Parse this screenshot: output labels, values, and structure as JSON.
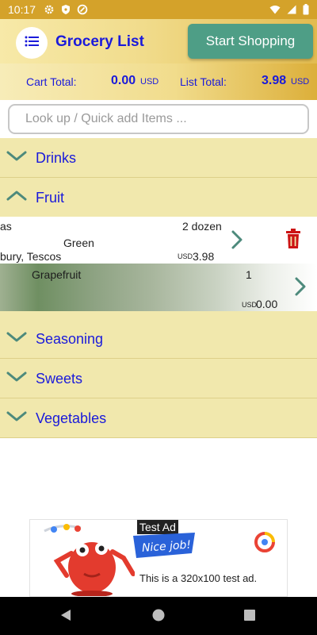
{
  "status_bar": {
    "time": "10:17"
  },
  "app_bar": {
    "title": "Grocery List",
    "start_button": "Start Shopping"
  },
  "totals": {
    "cart_label": "Cart Total:",
    "cart_value": "0.00",
    "cart_currency": "USD",
    "list_label": "List Total:",
    "list_value": "3.98",
    "list_currency": "USD"
  },
  "search": {
    "placeholder": "Look up / Quick add Items ..."
  },
  "categories": [
    {
      "label": "Drinks",
      "expanded": false
    },
    {
      "label": "Fruit",
      "expanded": true
    },
    {
      "label": "Seasoning",
      "expanded": false
    },
    {
      "label": "Sweets",
      "expanded": false
    },
    {
      "label": "Vegetables",
      "expanded": false
    }
  ],
  "fruit_items": [
    {
      "name": "as",
      "quantity": "2 dozen",
      "note": "Green",
      "stores": "bury, Tescos",
      "currency": "USD",
      "price": "3.98"
    },
    {
      "name": "Grapefruit",
      "quantity": "1",
      "currency": "USD",
      "price": "0.00"
    }
  ],
  "ad": {
    "tag": "Test Ad",
    "banner": "Nice job!",
    "text": "This is a 320x100 test ad."
  },
  "colors": {
    "accent_blue": "#1a1adb",
    "button_green": "#4e9e86",
    "category_bg": "#f1e8ad",
    "delete_red": "#cc1414"
  }
}
